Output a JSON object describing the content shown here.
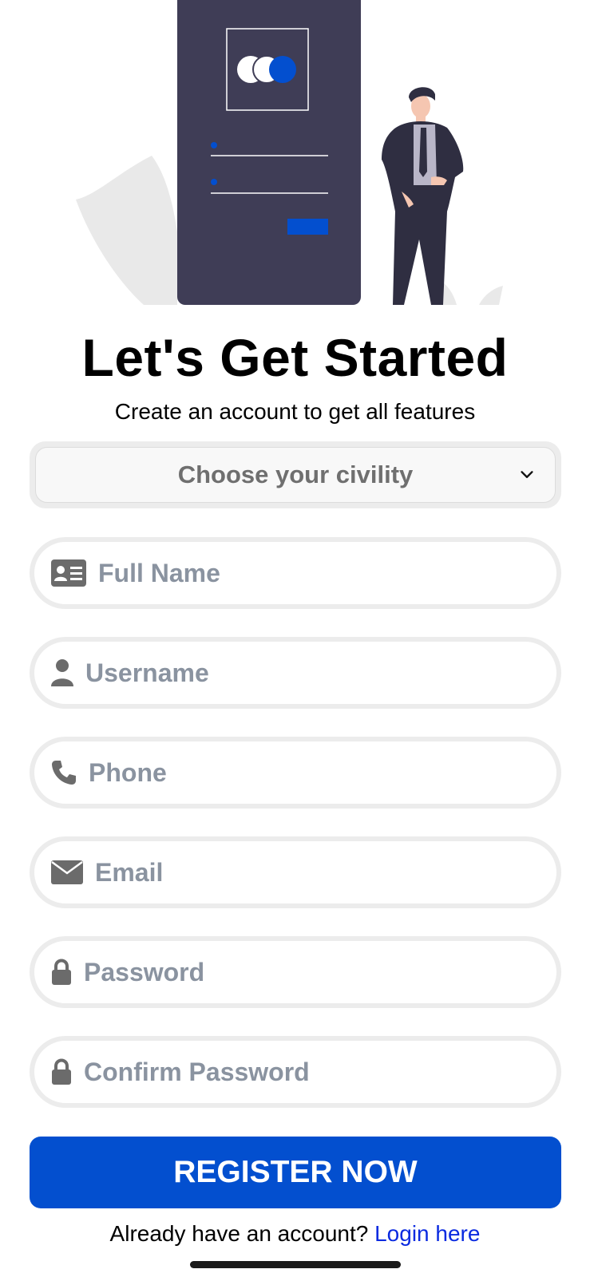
{
  "header": {
    "title": "Let's Get Started",
    "subtitle": "Create an account to get all features"
  },
  "civility_select": {
    "selected": "Choose your civility"
  },
  "fields": {
    "full_name": {
      "placeholder": "Full Name",
      "icon": "id-card-icon"
    },
    "username": {
      "placeholder": "Username",
      "icon": "user-icon"
    },
    "phone": {
      "placeholder": "Phone",
      "icon": "phone-icon"
    },
    "email": {
      "placeholder": "Email",
      "icon": "envelope-icon"
    },
    "password": {
      "placeholder": "Password",
      "icon": "lock-icon"
    },
    "confirm_password": {
      "placeholder": "Confirm Password",
      "icon": "lock-icon"
    }
  },
  "register_button": {
    "label": "REGISTER NOW"
  },
  "footer": {
    "prompt": "Already have an account?",
    "link": "Login here"
  },
  "colors": {
    "primary": "#034fcf",
    "link": "#0a2ae0",
    "placeholder": "#8a93a0",
    "icon": "#6b6b6b",
    "illustration_phone": "#3f3d56"
  }
}
